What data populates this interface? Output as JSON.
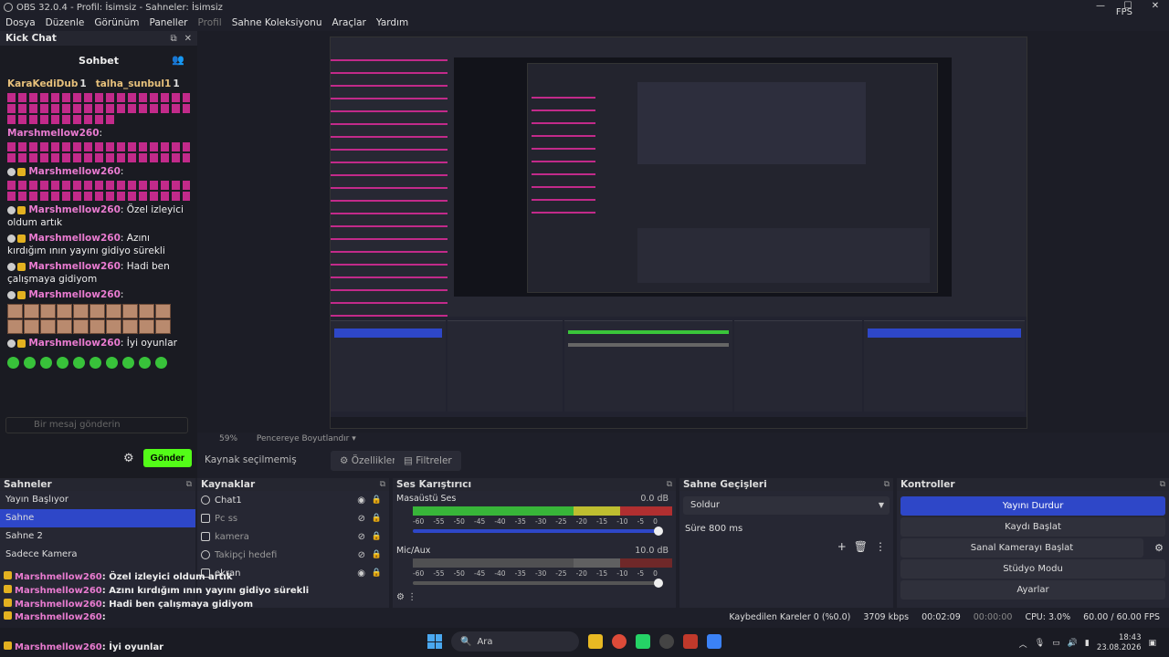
{
  "window": {
    "title": "OBS 32.0.4 - Profil: İsimsiz - Sahneler: İsimsiz",
    "fps_top": "FPS",
    "controls": [
      "—",
      "☐",
      "✕"
    ]
  },
  "menu": [
    "Dosya",
    "Düzenle",
    "Görünüm",
    "Paneller",
    "Profil",
    "Sahne Koleksiyonu",
    "Araçlar",
    "Yardım"
  ],
  "chat": {
    "title": "Kick Chat",
    "tab": "Sohbet",
    "top_users": [
      {
        "name": "KaraKediDub",
        "count": "1"
      },
      {
        "name": "talha_sunbul1",
        "count": "1"
      }
    ],
    "messages": [
      {
        "user": "Marshmellow260",
        "text": ""
      },
      {
        "user": "Marshmellow260",
        "text": ""
      },
      {
        "user": "Marshmellow260",
        "text": "Özel izleyici oldum artık"
      },
      {
        "user": "Marshmellow260",
        "text": "Azını kırdığım ının yayını gidiyo sürekli"
      },
      {
        "user": "Marshmellow260",
        "text": "Hadi ben çalışmaya gidiyom"
      },
      {
        "user": "Marshmellow260",
        "text": ""
      },
      {
        "user": "Marshmellow260",
        "text": "İyi oyunlar"
      }
    ],
    "input_placeholder": "Bir mesaj gönderin",
    "send_label": "Gönder"
  },
  "preview": {
    "zoom": "59%",
    "resize_label": "Pencereye Boyutlandır",
    "no_source": "Kaynak seçilmemiş",
    "properties_label": "Özellikler",
    "filters_label": "Filtreler"
  },
  "scenes": {
    "title": "Sahneler",
    "items": [
      {
        "label": "Yayın Başlıyor",
        "selected": false
      },
      {
        "label": "Sahne",
        "selected": true
      },
      {
        "label": "Sahne 2",
        "selected": false
      },
      {
        "label": "Sadece Kamera",
        "selected": false
      }
    ]
  },
  "sources": {
    "title": "Kaynaklar",
    "items": [
      {
        "label": "Chat1",
        "visible": true
      },
      {
        "label": "Pc ss",
        "visible": false
      },
      {
        "label": "kamera",
        "visible": false
      },
      {
        "label": "Takipçi hedefi",
        "visible": false
      },
      {
        "label": "ekran",
        "visible": true
      }
    ]
  },
  "mixer": {
    "title": "Ses Karıştırıcı",
    "channels": [
      {
        "name": "Masaüstü Ses",
        "db": "0.0 dB",
        "level": 0.62,
        "muted": false
      },
      {
        "name": "Mic/Aux",
        "db": "10.0 dB",
        "level": 0.0,
        "muted": true
      }
    ],
    "ticks": [
      "-60",
      "-55",
      "-50",
      "-45",
      "-40",
      "-35",
      "-30",
      "-25",
      "-20",
      "-15",
      "-10",
      "-5",
      "0"
    ]
  },
  "transitions": {
    "title": "Sahne Geçişleri",
    "selected": "Soldur",
    "duration_label": "Süre",
    "duration_value": "800 ms"
  },
  "controls": {
    "title": "Kontroller",
    "buttons": [
      {
        "label": "Yayını Durdur",
        "active": true
      },
      {
        "label": "Kaydı Başlat",
        "active": false
      },
      {
        "label": "Sanal Kamerayı Başlat",
        "active": false
      },
      {
        "label": "Stüdyo Modu",
        "active": false
      },
      {
        "label": "Ayarlar",
        "active": false
      }
    ]
  },
  "status": {
    "dropped": "Kaybedilen Kareler 0 (%0.0)",
    "bitrate": "3709 kbps",
    "stream_time": "00:02:09",
    "rec_time": "00:00:00",
    "cpu": "CPU: 3.0%",
    "fps": "60.00 / 60.00 FPS"
  },
  "taskbar": {
    "search": "Ara",
    "time": "18:43",
    "date": "23.08.2026"
  },
  "colors": {
    "accent": "#2e47c8",
    "kick_green": "#53fc18",
    "username": "#e97bd0"
  }
}
